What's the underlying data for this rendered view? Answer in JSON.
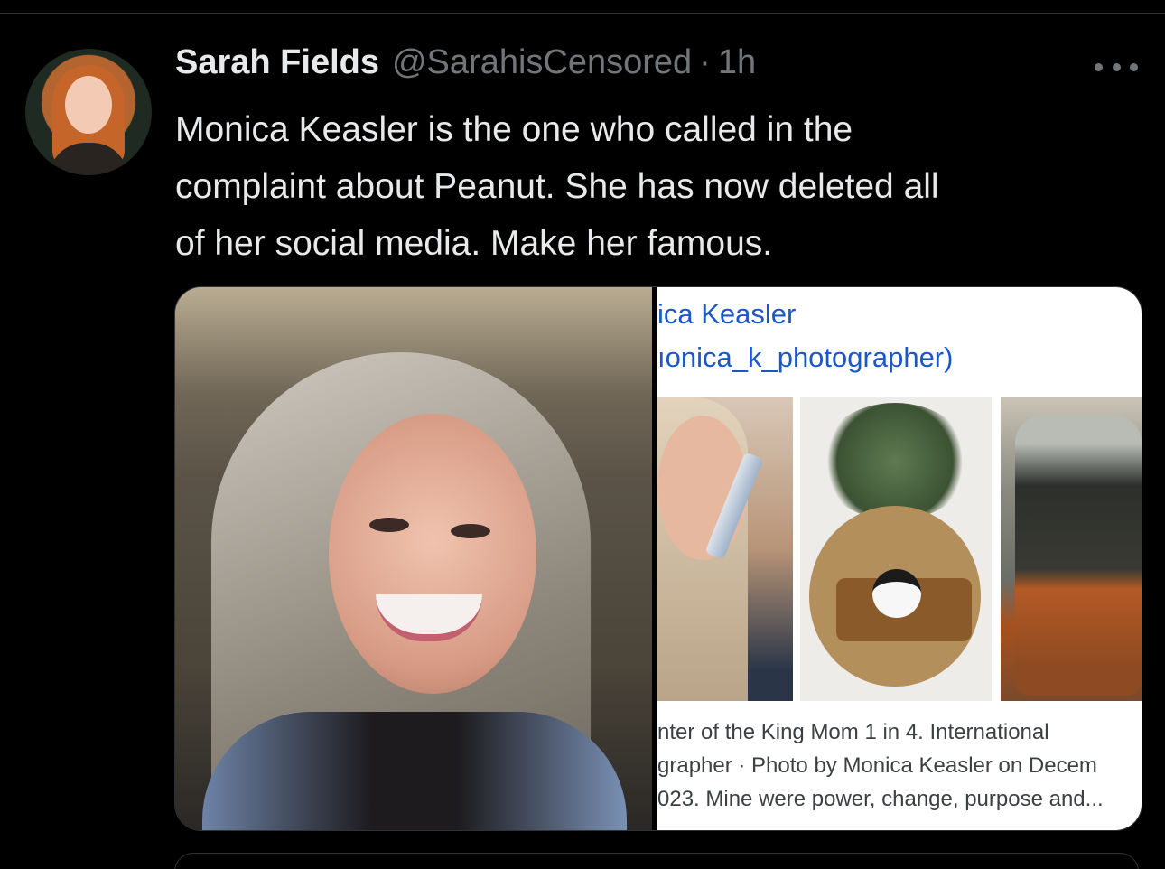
{
  "tweet": {
    "author": {
      "display_name": "Sarah Fields",
      "handle": "@SarahisCensored",
      "separator": "·",
      "time": "1h"
    },
    "more_icon": "more-horizontal-icon",
    "text_lines": [
      "Monica Keasler is the one who called in the",
      "complaint about Peanut. She has now deleted all",
      "of her social media. Make her famous."
    ],
    "media": {
      "right_image": {
        "profile_name": "ica Keasler",
        "profile_handle": "ıonica_k_photographer)",
        "caption_lines": [
          "nter of the King Mom 1 in 4. International",
          "grapher · Photo by Monica Keasler on Decem",
          "023. Mine were power, change, purpose and..."
        ]
      }
    }
  },
  "colors": {
    "background": "#000000",
    "text_primary": "#e7e9ea",
    "text_secondary": "#71767b",
    "link_blue": "#1a57c7",
    "divider": "#2f3336"
  }
}
